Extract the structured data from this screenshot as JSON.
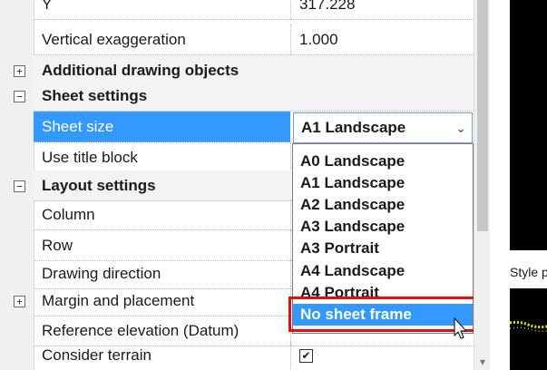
{
  "properties": {
    "rows": [
      {
        "name": "Y",
        "value": "317.228"
      },
      {
        "name": "Vertical exaggeration",
        "value": "1.000"
      },
      {
        "name": "Additional drawing objects",
        "category": true,
        "expander": "+"
      },
      {
        "name": "Sheet settings",
        "category": true,
        "expander": "−"
      },
      {
        "name": "Sheet size",
        "selected": true
      },
      {
        "name": "Use title block"
      },
      {
        "name": "Layout settings",
        "category": true,
        "expander": "−"
      },
      {
        "name": "Column"
      },
      {
        "name": "Row"
      },
      {
        "name": "Drawing direction"
      },
      {
        "name": "Margin and placement",
        "expander": "+"
      },
      {
        "name": "Reference elevation (Datum)"
      },
      {
        "name": "Consider terrain",
        "checked": true
      }
    ]
  },
  "sheet_size_dropdown": {
    "selected_value": "A1 Landscape",
    "arrow_icon": "chevron-down-icon",
    "options": [
      "A0 Landscape",
      "A1 Landscape",
      "A2 Landscape",
      "A3 Landscape",
      "A3 Portrait",
      "A4 Landscape",
      "A4 Portrait",
      "No sheet frame"
    ],
    "hovered_option": "No sheet frame",
    "highlight_color": "#3399ff",
    "annotation_box_color": "#e01010"
  },
  "style_panel": {
    "label": "Style p"
  },
  "checkbox_mark": "✔",
  "scroll_down_glyph": "▾"
}
